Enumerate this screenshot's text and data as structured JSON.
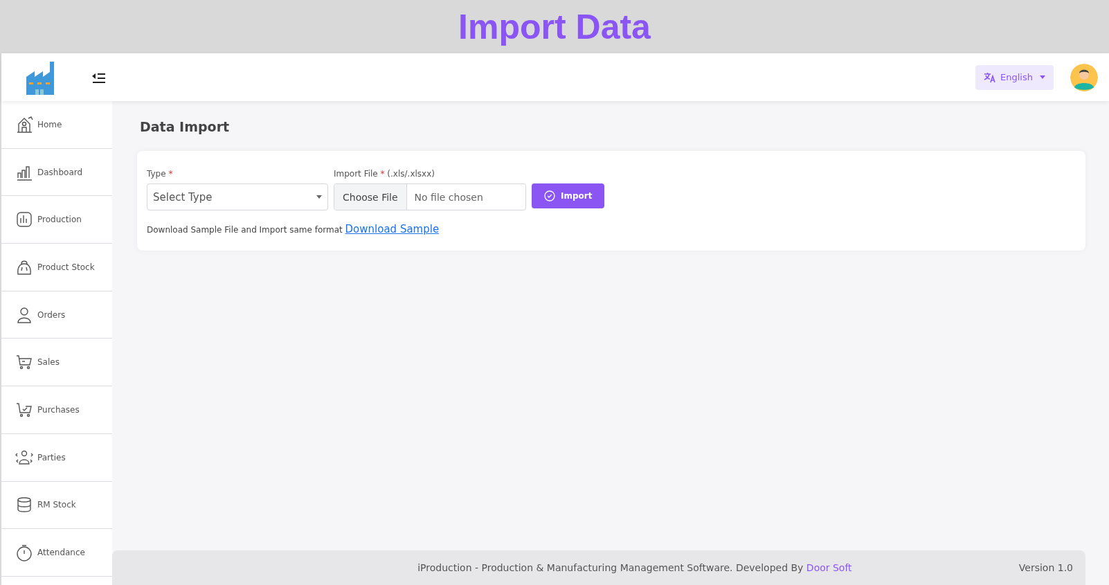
{
  "banner": {
    "title": "Import Data"
  },
  "header": {
    "language": {
      "label": "English"
    }
  },
  "sidebar": {
    "items": [
      {
        "label": "Home",
        "selected": false
      },
      {
        "label": "Dashboard",
        "selected": false
      },
      {
        "label": "Production",
        "selected": false
      },
      {
        "label": "Product Stock",
        "selected": false
      },
      {
        "label": "Orders",
        "selected": false
      },
      {
        "label": "Sales",
        "selected": false
      },
      {
        "label": "Purchases",
        "selected": false
      },
      {
        "label": "Parties",
        "selected": false
      },
      {
        "label": "RM Stock",
        "selected": false
      },
      {
        "label": "Attendance",
        "selected": false
      }
    ]
  },
  "page": {
    "title": "Data Import",
    "form": {
      "type_field": {
        "label": "Type",
        "required_mark": "*",
        "placeholder": "Select Type"
      },
      "file_field": {
        "label": "Import File",
        "required_mark": "*",
        "hint": "(.xls/.xlsxx)",
        "button": "Choose File",
        "status": "No file chosen"
      },
      "import_button": "Import",
      "help": {
        "text": "Download Sample File and Import same format",
        "link": "Download Sample"
      }
    }
  },
  "footer": {
    "text": "iProduction - Production & Manufacturing Management Software. Developed By",
    "link": "Door Soft",
    "version": "Version 1.0"
  }
}
